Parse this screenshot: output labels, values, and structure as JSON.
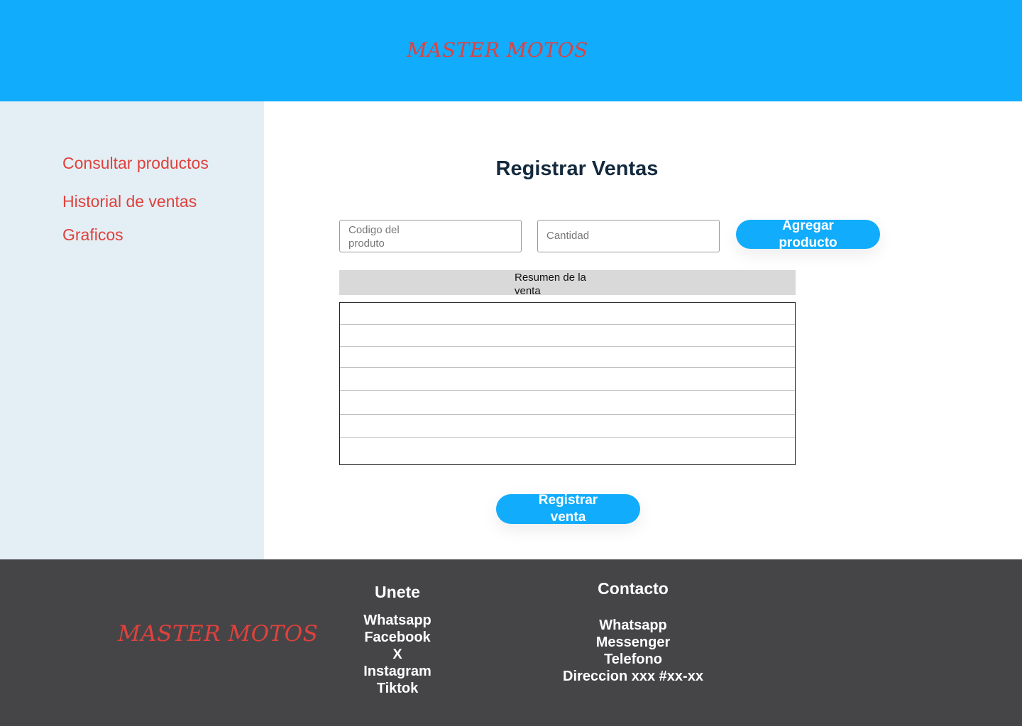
{
  "header": {
    "brand": "MASTER MOTOS"
  },
  "sidebar": {
    "items": [
      {
        "label": "Consultar productos"
      },
      {
        "label": "Historial de ventas"
      },
      {
        "label": "Graficos"
      }
    ]
  },
  "main": {
    "title": "Registrar Ventas",
    "product_code_placeholder": "Codigo del produto",
    "quantity_placeholder": "Cantidad",
    "add_button": "Agregar producto",
    "summary_title": "Resumen de la venta",
    "register_button": "Registrar venta"
  },
  "footer": {
    "brand": "MASTER MOTOS",
    "join": {
      "title": "Unete",
      "links": [
        "Whatsapp",
        "Facebook",
        "X",
        "Instagram",
        "Tiktok"
      ]
    },
    "contact": {
      "title": "Contacto",
      "items": [
        "Whatsapp",
        "Messenger",
        "Telefono",
        "Direccion xxx #xx-xx"
      ]
    }
  },
  "colors": {
    "accent": "#11acfc",
    "brand_red": "#e0413c",
    "sidebar_bg": "#e3eff5",
    "footer_bg": "#454548",
    "title_text": "#13293d"
  }
}
